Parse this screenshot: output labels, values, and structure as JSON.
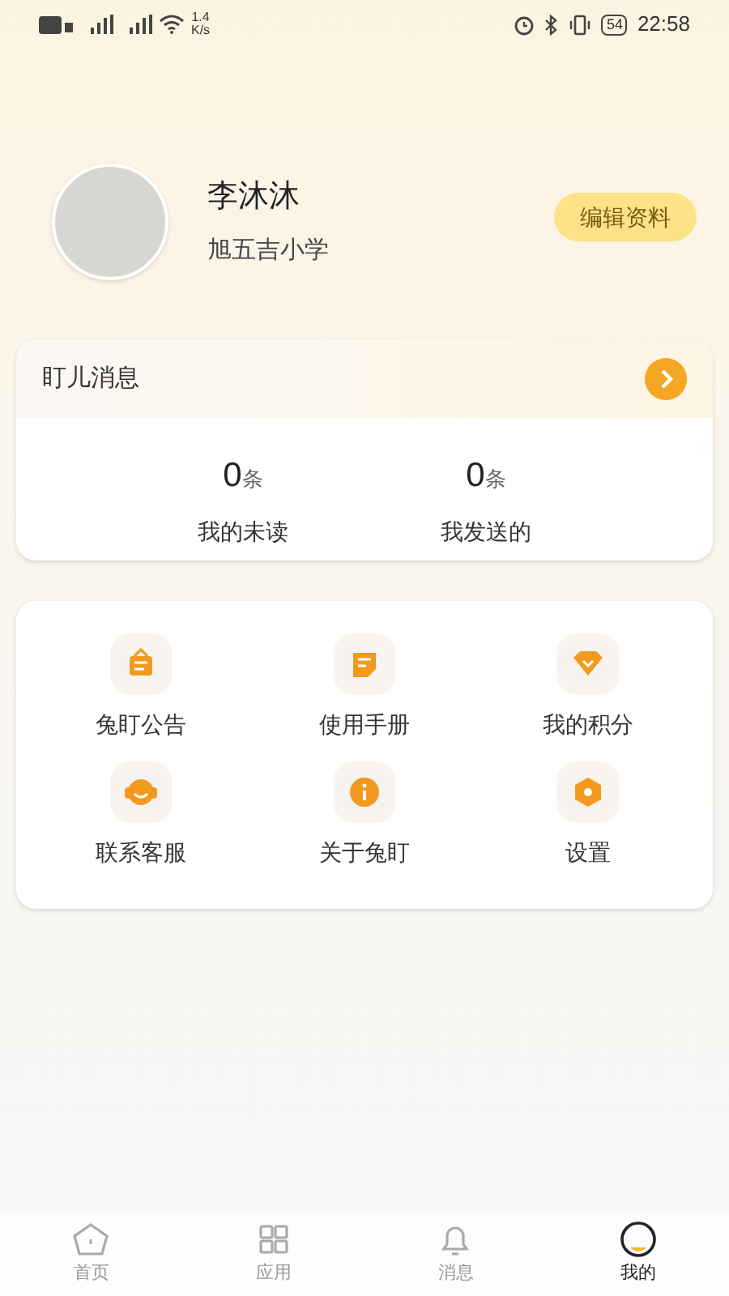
{
  "status_bar": {
    "network_speed": "1.4\nK/s",
    "battery": "54",
    "time": "22:58"
  },
  "profile": {
    "name": "李沐沐",
    "school": "旭五吉小学",
    "edit_button": "编辑资料"
  },
  "messages": {
    "title": "盯儿消息",
    "stats": [
      {
        "count": "0",
        "unit": "条",
        "label": "我的未读"
      },
      {
        "count": "0",
        "unit": "条",
        "label": "我发送的"
      }
    ]
  },
  "menu": [
    {
      "kind": "notice",
      "label": "兔盯公告"
    },
    {
      "kind": "manual",
      "label": "使用手册"
    },
    {
      "kind": "points",
      "label": "我的积分"
    },
    {
      "kind": "service",
      "label": "联系客服"
    },
    {
      "kind": "about",
      "label": "关于兔盯"
    },
    {
      "kind": "settings",
      "label": "设置"
    }
  ],
  "tabs": [
    {
      "kind": "home",
      "label": "首页",
      "selected": false
    },
    {
      "kind": "apps",
      "label": "应用",
      "selected": false
    },
    {
      "kind": "messages",
      "label": "消息",
      "selected": false
    },
    {
      "kind": "me",
      "label": "我的",
      "selected": true
    }
  ]
}
